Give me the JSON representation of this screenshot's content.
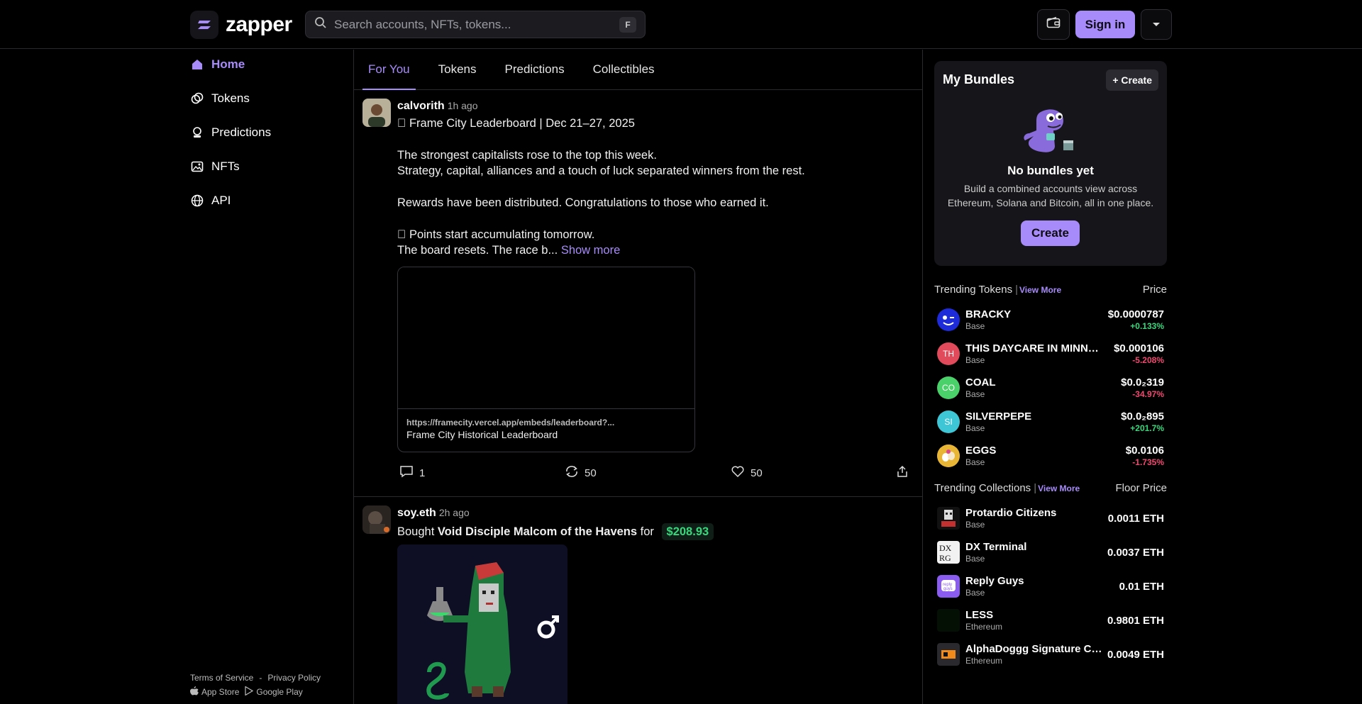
{
  "header": {
    "logo_text": "zapper",
    "search_placeholder": "Search accounts, NFTs, tokens...",
    "search_shortcut": "F",
    "sign_in": "Sign in"
  },
  "sidebar": {
    "items": [
      {
        "label": "Home",
        "icon": "home-icon",
        "active": true
      },
      {
        "label": "Tokens",
        "icon": "tokens-icon"
      },
      {
        "label": "Predictions",
        "icon": "predictions-icon"
      },
      {
        "label": "NFTs",
        "icon": "nft-icon"
      },
      {
        "label": "API",
        "icon": "globe-icon"
      }
    ],
    "footer": {
      "terms": "Terms of Service",
      "dash": "-",
      "privacy": "Privacy Policy",
      "app_store": "App Store",
      "google_play": "Google Play"
    }
  },
  "feed": {
    "tabs": [
      "For You",
      "Tokens",
      "Predictions",
      "Collectibles"
    ],
    "post1": {
      "author": "calvorith",
      "time": "1h ago",
      "line1": "󰀄 Frame City Leaderboard | Dec 21–27, 2025",
      "line2": "The strongest capitalists rose to the top this week.",
      "line3": "Strategy, capital, alliances and a touch of luck separated winners from the rest.",
      "line4": "Rewards have been distributed. Congratulations to those who earned it.",
      "line5": "󰀄 Points start accumulating tomorrow.",
      "line6": "The board resets. The race b...",
      "show_more": "Show more",
      "embed_url": "https://framecity.vercel.app/embeds/leaderboard?...",
      "embed_title": "Frame City Historical Leaderboard",
      "comments": "1",
      "recasts": "50",
      "likes": "50"
    },
    "post2": {
      "author": "soy.eth",
      "time": "2h ago",
      "bought": "Bought",
      "item": "Void Disciple Malcom of the Havens",
      "for": "for",
      "price": "$208.93"
    }
  },
  "bundles": {
    "title": "My Bundles",
    "create_small": "+ Create",
    "empty_title": "No bundles yet",
    "desc_line1": "Build a combined accounts view across",
    "desc_line2": "Ethereum, Solana and Bitcoin, all in one place.",
    "create_big": "Create"
  },
  "trending_tokens": {
    "title": "Trending Tokens",
    "sep": "|",
    "view_more": "View More",
    "col": "Price",
    "rows": [
      {
        "name": "BRACKY",
        "chain": "Base",
        "price": "$0.0000787",
        "change": "+0.133%",
        "dir": "up",
        "abbr": "",
        "color": "#1d2bd8"
      },
      {
        "name": "THIS DAYCARE IN MINNESOTA",
        "chain": "Base",
        "price": "$0.000106",
        "change": "-5.208%",
        "dir": "down",
        "abbr": "TH",
        "color": "#e04a5a"
      },
      {
        "name": "COAL",
        "chain": "Base",
        "price": "$0.0₂319",
        "change": "-34.97%",
        "dir": "down",
        "abbr": "CO",
        "color": "#4bd16a"
      },
      {
        "name": "SILVERPEPE",
        "chain": "Base",
        "price": "$0.0₂895",
        "change": "+201.7%",
        "dir": "up",
        "abbr": "SI",
        "color": "#3fc6d6"
      },
      {
        "name": "EGGS",
        "chain": "Base",
        "price": "$0.0106",
        "change": "-1.735%",
        "dir": "down",
        "abbr": "",
        "color": "#e8b634"
      }
    ]
  },
  "trending_collections": {
    "title": "Trending Collections",
    "sep": "|",
    "view_more": "View More",
    "col": "Floor Price",
    "rows": [
      {
        "name": "Protardio Citizens",
        "chain": "Base",
        "floor": "0.0011 ETH"
      },
      {
        "name": "DX Terminal",
        "chain": "Base",
        "floor": "0.0037 ETH"
      },
      {
        "name": "Reply Guys",
        "chain": "Base",
        "floor": "0.01 ETH"
      },
      {
        "name": "LESS",
        "chain": "Ethereum",
        "floor": "0.9801 ETH"
      },
      {
        "name": "AlphaDoggg Signature Collection",
        "chain": "Ethereum",
        "floor": "0.0049 ETH"
      }
    ]
  },
  "colors": {
    "accent": "#a88bfa",
    "up": "#37d87c",
    "down": "#f04870"
  }
}
